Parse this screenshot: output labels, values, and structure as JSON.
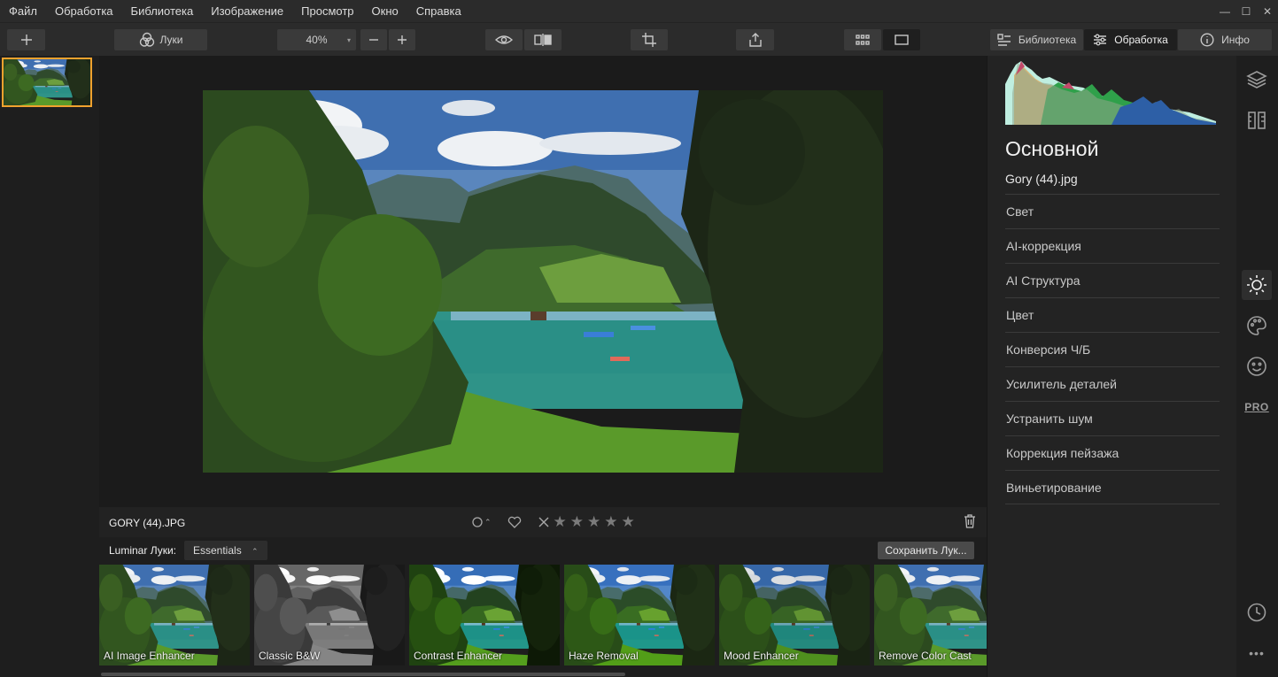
{
  "menu": {
    "items": [
      "Файл",
      "Обработка",
      "Библиотека",
      "Изображение",
      "Просмотр",
      "Окно",
      "Справка"
    ],
    "window_controls": [
      "—",
      "☐",
      "✕"
    ]
  },
  "toolbar": {
    "add_icon": "plus-icon",
    "looks_label": "Луки",
    "zoom_value": "40%",
    "zoom_caret": "▾",
    "library_label": "Библиотека",
    "edit_label": "Обработка",
    "info_label": "Инфо"
  },
  "image": {
    "filename_upper": "GORY (44).JPG",
    "filename": "Gory (44).jpg",
    "rating_stars": 0,
    "flag_caret": "⌃",
    "stars": [
      "★",
      "★",
      "★",
      "★",
      "★"
    ]
  },
  "looks": {
    "label": "Luminar Луки:",
    "category": "Essentials",
    "category_caret": "⌃",
    "save_label": "Сохранить Лук...",
    "items": [
      {
        "name": "AI Image Enhancer"
      },
      {
        "name": "Classic B&W"
      },
      {
        "name": "Contrast Enhancer"
      },
      {
        "name": "Haze Removal"
      },
      {
        "name": "Mood Enhancer"
      },
      {
        "name": "Remove Color Cast"
      }
    ]
  },
  "panel": {
    "title": "Основной",
    "filename": "Gory (44).jpg",
    "sections": [
      "Свет",
      "AI-коррекция",
      "AI Структура",
      "Цвет",
      "Конверсия Ч/Б",
      "Усилитель деталей",
      "Устранить шум",
      "Коррекция пейзажа",
      "Виньетирование"
    ]
  },
  "rail": {
    "pro_label": "PRO",
    "more_label": "•••"
  },
  "colors": {
    "selection": "#f0a22e",
    "background": "#1e1e1e",
    "panel": "#232323"
  }
}
